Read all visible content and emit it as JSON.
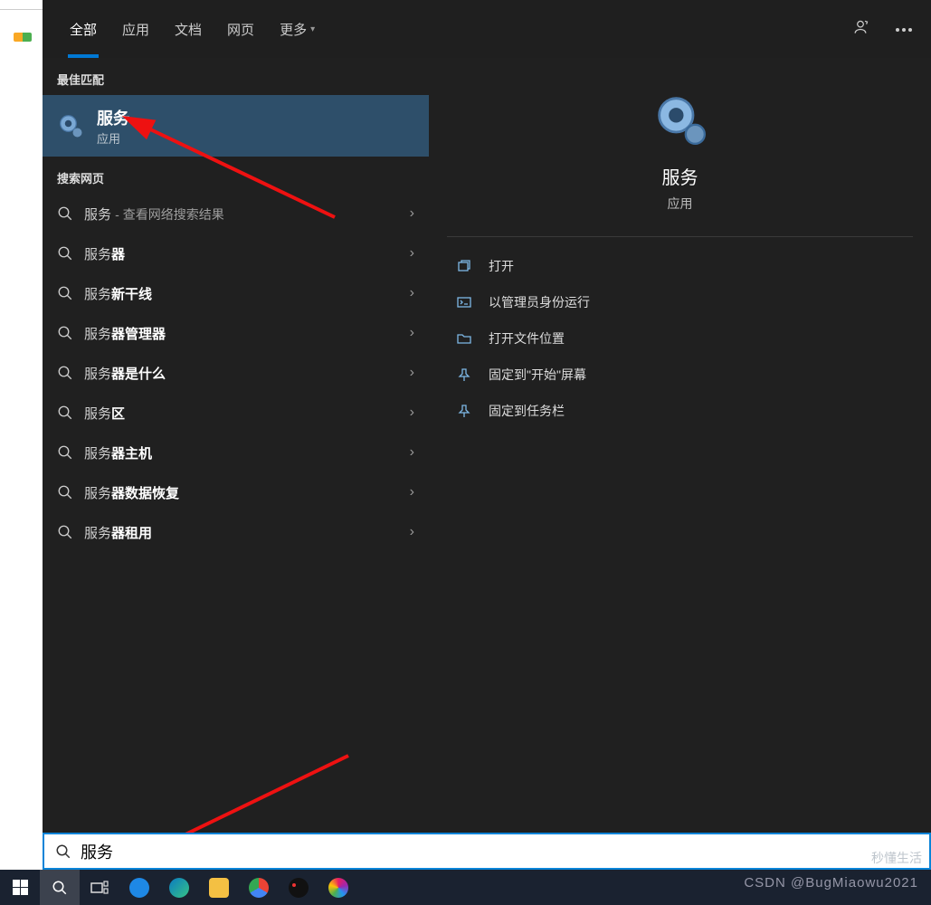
{
  "tabs": {
    "all": "全部",
    "apps": "应用",
    "docs": "文档",
    "web": "网页",
    "more": "更多"
  },
  "left": {
    "best_header": "最佳匹配",
    "best_title": "服务",
    "best_sub": "应用",
    "web_header": "搜索网页",
    "rows": [
      {
        "light": "服务 ",
        "note": "- 查看网络搜索结果",
        "bold": ""
      },
      {
        "light": "服务",
        "bold": "器"
      },
      {
        "light": "服务",
        "bold": "新干线"
      },
      {
        "light": "服务",
        "bold": "器管理器"
      },
      {
        "light": "服务",
        "bold": "器是什么"
      },
      {
        "light": "服务",
        "bold": "区"
      },
      {
        "light": "服务",
        "bold": "器主机"
      },
      {
        "light": "服务",
        "bold": "器数据恢复"
      },
      {
        "light": "服务",
        "bold": "器租用"
      }
    ]
  },
  "right": {
    "title": "服务",
    "sub": "应用",
    "actions": [
      {
        "icon": "open",
        "label": "打开"
      },
      {
        "icon": "admin",
        "label": "以管理员身份运行"
      },
      {
        "icon": "folder",
        "label": "打开文件位置"
      },
      {
        "icon": "pin-start",
        "label": "固定到\"开始\"屏幕"
      },
      {
        "icon": "pin-task",
        "label": "固定到任务栏"
      }
    ]
  },
  "search_input": "服务",
  "watermark": "CSDN @BugMiaowu2021",
  "watermark2": "秒懂生活"
}
